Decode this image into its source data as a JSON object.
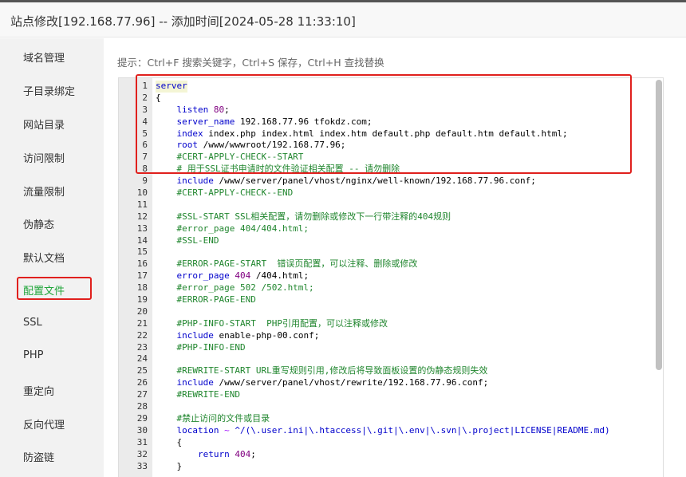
{
  "window": {
    "title": "站点修改[192.168.77.96] -- 添加时间[2024-05-28 11:33:10]"
  },
  "sidebar": {
    "items": [
      {
        "label": "域名管理"
      },
      {
        "label": "子目录绑定"
      },
      {
        "label": "网站目录"
      },
      {
        "label": "访问限制"
      },
      {
        "label": "流量限制"
      },
      {
        "label": "伪静态"
      },
      {
        "label": "默认文档"
      },
      {
        "label": "配置文件",
        "active": true
      },
      {
        "label": "SSL"
      },
      {
        "label": "PHP"
      },
      {
        "label": "重定向"
      },
      {
        "label": "反向代理"
      },
      {
        "label": "防盗链"
      }
    ]
  },
  "hint": "提示：Ctrl+F 搜索关键字，Ctrl+S 保存，Ctrl+H 查找替换",
  "editor": {
    "lines": [
      {
        "n": "1",
        "t": "server"
      },
      {
        "n": "2",
        "t": "{"
      },
      {
        "n": "3",
        "t": "    listen 80;"
      },
      {
        "n": "4",
        "t": "    server_name 192.168.77.96 tfokdz.com;"
      },
      {
        "n": "5",
        "t": "    index index.php index.html index.htm default.php default.htm default.html;"
      },
      {
        "n": "6",
        "t": "    root /www/wwwroot/192.168.77.96;"
      },
      {
        "n": "7",
        "t": "    #CERT-APPLY-CHECK--START"
      },
      {
        "n": "8",
        "t": "    # 用于SSL证书申请时的文件验证相关配置 -- 请勿删除"
      },
      {
        "n": "9",
        "t": "    include /www/server/panel/vhost/nginx/well-known/192.168.77.96.conf;"
      },
      {
        "n": "10",
        "t": "    #CERT-APPLY-CHECK--END"
      },
      {
        "n": "11",
        "t": ""
      },
      {
        "n": "12",
        "t": "    #SSL-START SSL相关配置，请勿删除或修改下一行带注释的404规则"
      },
      {
        "n": "13",
        "t": "    #error_page 404/404.html;"
      },
      {
        "n": "14",
        "t": "    #SSL-END"
      },
      {
        "n": "15",
        "t": ""
      },
      {
        "n": "16",
        "t": "    #ERROR-PAGE-START  错误页配置，可以注释、删除或修改"
      },
      {
        "n": "17",
        "t": "    error_page 404 /404.html;"
      },
      {
        "n": "18",
        "t": "    #error_page 502 /502.html;"
      },
      {
        "n": "19",
        "t": "    #ERROR-PAGE-END"
      },
      {
        "n": "20",
        "t": ""
      },
      {
        "n": "21",
        "t": "    #PHP-INFO-START  PHP引用配置，可以注释或修改"
      },
      {
        "n": "22",
        "t": "    include enable-php-00.conf;"
      },
      {
        "n": "23",
        "t": "    #PHP-INFO-END"
      },
      {
        "n": "24",
        "t": ""
      },
      {
        "n": "25",
        "t": "    #REWRITE-START URL重写规则引用,修改后将导致面板设置的伪静态规则失效"
      },
      {
        "n": "26",
        "t": "    include /www/server/panel/vhost/rewrite/192.168.77.96.conf;"
      },
      {
        "n": "27",
        "t": "    #REWRITE-END"
      },
      {
        "n": "28",
        "t": ""
      },
      {
        "n": "29",
        "t": "    #禁止访问的文件或目录"
      },
      {
        "n": "30",
        "t": "    location ~ ^/(\\.user.ini|\\.htaccess|\\.git|\\.env|\\.svn|\\.project|LICENSE|README.md)"
      },
      {
        "n": "31",
        "t": "    {"
      },
      {
        "n": "32",
        "t": "        return 404;"
      },
      {
        "n": "33",
        "t": "    }"
      }
    ]
  },
  "colors": {
    "accent_green": "#20a53a",
    "annotation_red": "#e0201d",
    "keyword_blue": "#0000cc",
    "comment_green": "#20862e",
    "number_purple": "#800080"
  }
}
